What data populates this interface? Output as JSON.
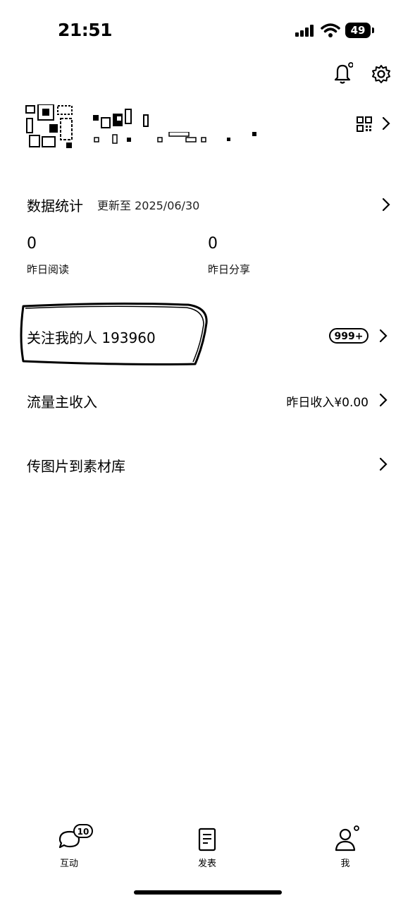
{
  "status_bar": {
    "time": "21:51",
    "battery": "49"
  },
  "stats": {
    "title": "数据统计",
    "updated": "更新至 2025/06/30",
    "items": [
      {
        "value": "0",
        "label": "昨日阅读"
      },
      {
        "value": "0",
        "label": "昨日分享"
      }
    ]
  },
  "rows": {
    "followers": {
      "label": "关注我的人 193960",
      "badge": "999+"
    },
    "income": {
      "label": "流量主收入",
      "right": "昨日收入¥0.00"
    },
    "upload": {
      "label": "传图片到素材库"
    }
  },
  "tabbar": {
    "items": [
      {
        "label": "互动",
        "icon": "chat-icon",
        "badge": "10"
      },
      {
        "label": "发表",
        "icon": "document-icon"
      },
      {
        "label": "我",
        "icon": "person-icon"
      }
    ]
  }
}
